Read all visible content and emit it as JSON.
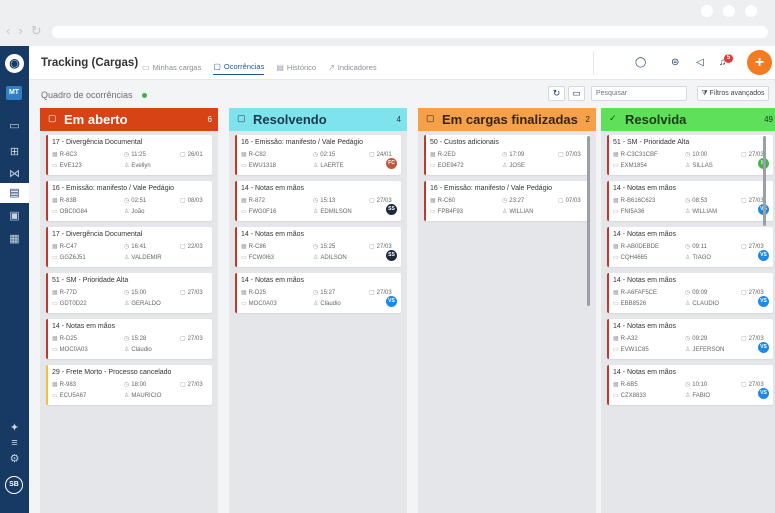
{
  "colors": {
    "sidebar": "#163a63",
    "accent": "#f47b20",
    "link": "#1f5b96"
  },
  "app": {
    "logo_icon": "location-pin-icon",
    "org_badge": "MT",
    "user_initials": "SB",
    "title": "Tracking (Cargas)"
  },
  "tabs": [
    {
      "label": "Minhas cargas",
      "icon": "truck-icon"
    },
    {
      "label": "Ocorrências",
      "icon": "chat-icon"
    },
    {
      "label": "Histórico",
      "icon": "document-icon"
    },
    {
      "label": "Indicadores",
      "icon": "chart-icon"
    }
  ],
  "header_actions": {
    "notification_count": "5",
    "add_label": "+"
  },
  "board": {
    "subtitle": "Quadro de ocorrências",
    "search_placeholder": "Pesquisar",
    "filters_label": "Filtros avançados",
    "filters_icon": "filter-icon",
    "refresh_icon": "refresh-icon",
    "monitor_icon": "monitor-icon"
  },
  "columns": [
    {
      "title": "Em aberto",
      "count": "6",
      "color": "#d84315",
      "text_color": "#ffffff",
      "icon": "chat-icon",
      "cards": [
        {
          "title": "17 - Divergência Documental",
          "ref": "R-6C3",
          "time": "11:25",
          "date": "26/01",
          "plate": "EVE123",
          "user": "Evellyn",
          "avatar": "",
          "avatar_color": "",
          "accent": "red"
        },
        {
          "title": "16 - Emissão: manifesto / Vale Pedágio",
          "ref": "R-83B",
          "time": "02:51",
          "date": "08/03",
          "plate": "OBC0G84",
          "user": "João",
          "avatar": "",
          "avatar_color": "",
          "accent": "red"
        },
        {
          "title": "17 - Divergência Documental",
          "ref": "R-C47",
          "time": "16:41",
          "date": "22/03",
          "plate": "GGZ6J51",
          "user": "VALDEMIR",
          "avatar": "",
          "avatar_color": "",
          "accent": "red"
        },
        {
          "title": "51 - SM - Prioridade Alta",
          "ref": "R-77D",
          "time": "15:00",
          "date": "27/03",
          "plate": "GDT0D22",
          "user": "GERALDO",
          "avatar": "",
          "avatar_color": "",
          "accent": "red"
        },
        {
          "title": "14 - Notas em mãos",
          "ref": "R-D25",
          "time": "15:28",
          "date": "27/03",
          "plate": "MOC0A03",
          "user": "Cláudio",
          "avatar": "",
          "avatar_color": "",
          "accent": "red"
        },
        {
          "title": "29 - Frete Morto - Processo cancelado",
          "ref": "R-983",
          "time": "18:00",
          "date": "27/03",
          "plate": "ECU5A67",
          "user": "MAURICIO",
          "avatar": "",
          "avatar_color": "",
          "accent": "yellow"
        }
      ]
    },
    {
      "title": "Resolvendo",
      "count": "4",
      "color": "#7fe3ee",
      "text_color": "#1b3a4d",
      "icon": "chat-icon",
      "cards": [
        {
          "title": "16 - Emissão: manifesto / Vale Pedágio",
          "ref": "R-C82",
          "time": "02:15",
          "date": "24/01",
          "plate": "EWU1318",
          "user": "LAERTE",
          "avatar": "FC",
          "avatar_color": "#c0583a",
          "accent": "red"
        },
        {
          "title": "14 - Notas em mãos",
          "ref": "R-872",
          "time": "15:13",
          "date": "27/03",
          "plate": "FWG0F16",
          "user": "EDMILSON",
          "avatar": "SS",
          "avatar_color": "#1d2b3a",
          "accent": "red"
        },
        {
          "title": "14 - Notas em mãos",
          "ref": "R-C86",
          "time": "15:25",
          "date": "27/03",
          "plate": "FCW0I63",
          "user": "ADILSON",
          "avatar": "SS",
          "avatar_color": "#1d2b3a",
          "accent": "red"
        },
        {
          "title": "14 - Notas em mãos",
          "ref": "R-D25",
          "time": "15:27",
          "date": "27/03",
          "plate": "MOC0A03",
          "user": "Cláudio",
          "avatar": "VS",
          "avatar_color": "#1e88e5",
          "accent": "red"
        }
      ]
    },
    {
      "title": "Em cargas finalizadas",
      "count": "2",
      "color": "#f4a14a",
      "text_color": "#3a2410",
      "icon": "chat-icon",
      "cards": [
        {
          "title": "50 - Custos adicionais",
          "ref": "R-2ED",
          "time": "17:09",
          "date": "07/03",
          "plate": "EOE9472",
          "user": "JOSE",
          "avatar": "",
          "avatar_color": "",
          "accent": "red"
        },
        {
          "title": "16 - Emissão: manifesto / Vale Pedágio",
          "ref": "R-C60",
          "time": "23:27",
          "date": "07/03",
          "plate": "FPB4F93",
          "user": "WILLIAN",
          "avatar": "",
          "avatar_color": "",
          "accent": "red"
        }
      ]
    },
    {
      "title": "Resolvida",
      "count": "49",
      "color": "#5fe05a",
      "text_color": "#1d3a1a",
      "icon": "check-icon",
      "cards": [
        {
          "title": "51 - SM - Prioridade Alta",
          "ref": "R-C3C31CBF",
          "time": "10:00",
          "date": "27/03",
          "plate": "EXM1854",
          "user": "SILLAS",
          "avatar": "IS",
          "avatar_color": "#43b649",
          "accent": "red"
        },
        {
          "title": "14 - Notas em mãos",
          "ref": "R-B616C623",
          "time": "08:53",
          "date": "27/03",
          "plate": "FNI5A36",
          "user": "WILLIAM",
          "avatar": "VS",
          "avatar_color": "#1e88e5",
          "accent": "red"
        },
        {
          "title": "14 - Notas em mãos",
          "ref": "R-AB0DEBDE",
          "time": "09:11",
          "date": "27/03",
          "plate": "CQH4665",
          "user": "TIAGO",
          "avatar": "VS",
          "avatar_color": "#1e88e5",
          "accent": "red"
        },
        {
          "title": "14 - Notas em mãos",
          "ref": "R-A6FAF5CE",
          "time": "09:09",
          "date": "27/03",
          "plate": "EBB8526",
          "user": "CLAUDIO",
          "avatar": "VS",
          "avatar_color": "#1e88e5",
          "accent": "red"
        },
        {
          "title": "14 - Notas em mãos",
          "ref": "R-A32",
          "time": "09:29",
          "date": "27/03",
          "plate": "EVW1C85",
          "user": "JEFERSON",
          "avatar": "VS",
          "avatar_color": "#1e88e5",
          "accent": "red"
        },
        {
          "title": "14 - Notas em mãos",
          "ref": "R-6B5",
          "time": "10:10",
          "date": "27/03",
          "plate": "CZX8833",
          "user": "FABIO",
          "avatar": "VS",
          "avatar_color": "#1e88e5",
          "accent": "red"
        }
      ]
    }
  ]
}
